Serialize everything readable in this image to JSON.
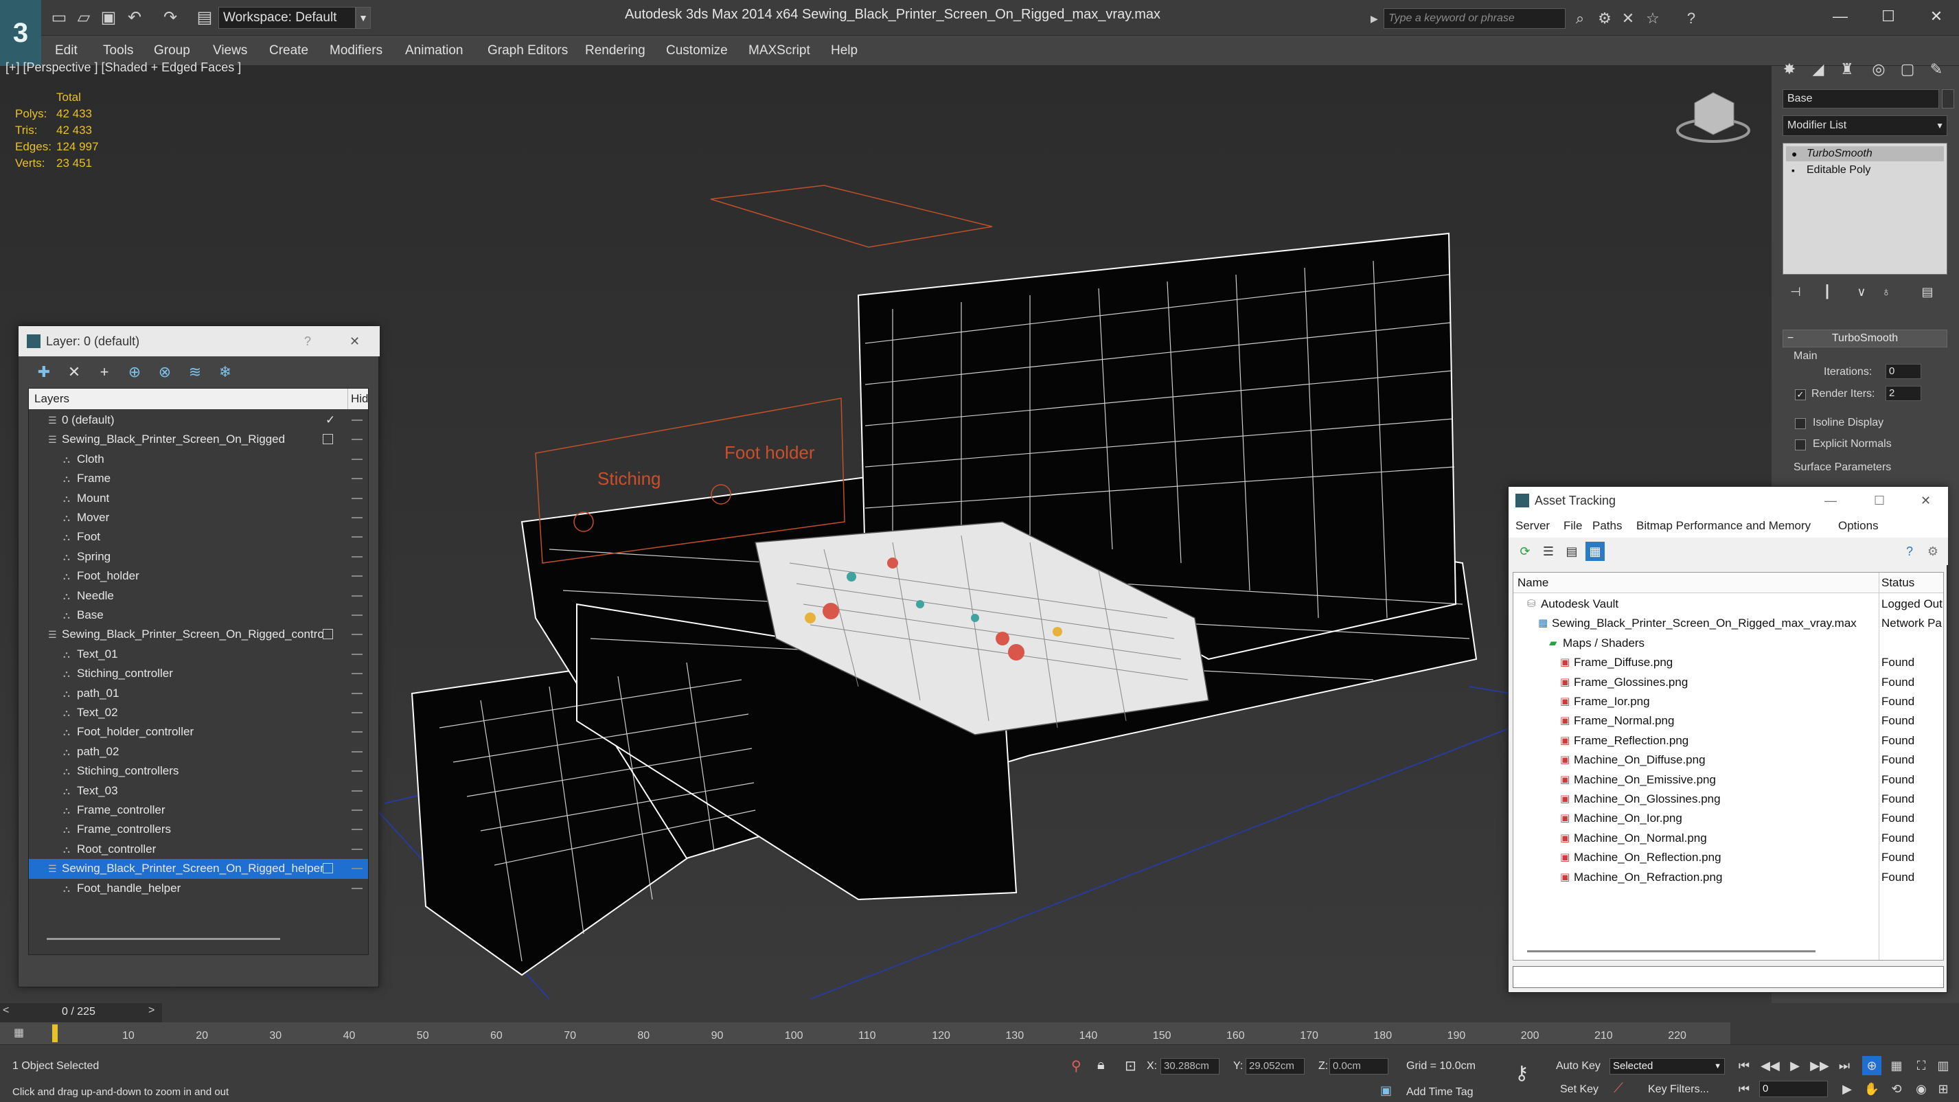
{
  "app": {
    "title": "Autodesk 3ds Max  2014 x64     Sewing_Black_Printer_Screen_On_Rigged_max_vray.max",
    "workspace": "Workspace: Default",
    "search_placeholder": "Type a keyword or phrase",
    "logo": "3"
  },
  "menu": [
    "Edit",
    "Tools",
    "Group",
    "Views",
    "Create",
    "Modifiers",
    "Animation",
    "Graph Editors",
    "Rendering",
    "Customize",
    "MAXScript",
    "Help"
  ],
  "viewport": {
    "label": "[+] [Perspective ] [Shaded + Edged Faces ]",
    "stats_header": "Total",
    "stats": [
      {
        "k": "Polys:",
        "v": "42 433"
      },
      {
        "k": "Tris:",
        "v": "42 433"
      },
      {
        "k": "Edges:",
        "v": "124 997"
      },
      {
        "k": "Verts:",
        "v": "23 451"
      }
    ],
    "scene_labels": {
      "stitching": "Stiching",
      "foot_holder": "Foot holder"
    }
  },
  "command_panel": {
    "object_name": "Base",
    "modifier_list": "Modifier List",
    "stack": [
      "TurboSmooth",
      "Editable Poly"
    ],
    "rollout": "TurboSmooth",
    "main_group": "Main",
    "iterations_label": "Iterations:",
    "iterations_value": "0",
    "render_iters_label": "Render Iters:",
    "render_iters_value": "2",
    "isoline_label": "Isoline Display",
    "explicit_normals_label": "Explicit Normals",
    "surface_params_label": "Surface Parameters"
  },
  "layer_window": {
    "title": "Layer: 0 (default)",
    "help": "?",
    "close": "✕",
    "col_layers": "Layers",
    "col_hide": "Hid",
    "rows": [
      {
        "name": "0 (default)",
        "indent": 1,
        "type": "layer",
        "checked": true
      },
      {
        "name": "Sewing_Black_Printer_Screen_On_Rigged",
        "indent": 1,
        "type": "layer",
        "box": true
      },
      {
        "name": "Cloth",
        "indent": 2,
        "type": "obj"
      },
      {
        "name": "Frame",
        "indent": 2,
        "type": "obj"
      },
      {
        "name": "Mount",
        "indent": 2,
        "type": "obj"
      },
      {
        "name": "Mover",
        "indent": 2,
        "type": "obj"
      },
      {
        "name": "Foot",
        "indent": 2,
        "type": "obj"
      },
      {
        "name": "Spring",
        "indent": 2,
        "type": "obj"
      },
      {
        "name": "Foot_holder",
        "indent": 2,
        "type": "obj"
      },
      {
        "name": "Needle",
        "indent": 2,
        "type": "obj"
      },
      {
        "name": "Base",
        "indent": 2,
        "type": "obj"
      },
      {
        "name": "Sewing_Black_Printer_Screen_On_Rigged_controllers",
        "indent": 1,
        "type": "layer",
        "box": true
      },
      {
        "name": "Text_01",
        "indent": 2,
        "type": "obj"
      },
      {
        "name": "Stiching_controller",
        "indent": 2,
        "type": "obj"
      },
      {
        "name": "path_01",
        "indent": 2,
        "type": "obj"
      },
      {
        "name": "Text_02",
        "indent": 2,
        "type": "obj"
      },
      {
        "name": "Foot_holder_controller",
        "indent": 2,
        "type": "obj"
      },
      {
        "name": "path_02",
        "indent": 2,
        "type": "obj"
      },
      {
        "name": "Stiching_controllers",
        "indent": 2,
        "type": "obj"
      },
      {
        "name": "Text_03",
        "indent": 2,
        "type": "obj"
      },
      {
        "name": "Frame_controller",
        "indent": 2,
        "type": "obj"
      },
      {
        "name": "Frame_controllers",
        "indent": 2,
        "type": "obj"
      },
      {
        "name": "Root_controller",
        "indent": 2,
        "type": "obj"
      },
      {
        "name": "Sewing_Black_Printer_Screen_On_Rigged_helpers",
        "indent": 1,
        "type": "layer",
        "box": true,
        "selected": true
      },
      {
        "name": "Foot_handle_helper",
        "indent": 2,
        "type": "obj"
      }
    ]
  },
  "asset_window": {
    "title": "Asset Tracking",
    "menus": [
      "Server",
      "File",
      "Paths",
      "Bitmap Performance and Memory",
      "Options"
    ],
    "col_name": "Name",
    "col_status": "Status",
    "rows": [
      {
        "name": "Autodesk Vault",
        "indent": 1,
        "status": "Logged Out"
      },
      {
        "name": "Sewing_Black_Printer_Screen_On_Rigged_max_vray.max",
        "indent": 2,
        "status": "Network Pa"
      },
      {
        "name": "Maps / Shaders",
        "indent": 3,
        "status": ""
      },
      {
        "name": "Frame_Diffuse.png",
        "indent": 4,
        "status": "Found"
      },
      {
        "name": "Frame_Glossines.png",
        "indent": 4,
        "status": "Found"
      },
      {
        "name": "Frame_Ior.png",
        "indent": 4,
        "status": "Found"
      },
      {
        "name": "Frame_Normal.png",
        "indent": 4,
        "status": "Found"
      },
      {
        "name": "Frame_Reflection.png",
        "indent": 4,
        "status": "Found"
      },
      {
        "name": "Machine_On_Diffuse.png",
        "indent": 4,
        "status": "Found"
      },
      {
        "name": "Machine_On_Emissive.png",
        "indent": 4,
        "status": "Found"
      },
      {
        "name": "Machine_On_Glossines.png",
        "indent": 4,
        "status": "Found"
      },
      {
        "name": "Machine_On_Ior.png",
        "indent": 4,
        "status": "Found"
      },
      {
        "name": "Machine_On_Normal.png",
        "indent": 4,
        "status": "Found"
      },
      {
        "name": "Machine_On_Reflection.png",
        "indent": 4,
        "status": "Found"
      },
      {
        "name": "Machine_On_Refraction.png",
        "indent": 4,
        "status": "Found"
      }
    ]
  },
  "timeline": {
    "frame": "0 / 225",
    "ticks": [
      "10",
      "20",
      "30",
      "40",
      "50",
      "60",
      "70",
      "80",
      "90",
      "100",
      "110",
      "120",
      "130",
      "140",
      "150",
      "160",
      "170",
      "180",
      "190",
      "200",
      "210",
      "220"
    ]
  },
  "status": {
    "selection": "1 Object Selected",
    "hint": "Click and drag up-and-down to zoom in and out",
    "x_label": "X:",
    "x_value": "30.288cm",
    "y_label": "Y:",
    "y_value": "29.052cm",
    "z_label": "Z:",
    "z_value": "0.0cm",
    "grid": "Grid = 10.0cm",
    "add_time_tag": "Add Time Tag",
    "auto_key": "Auto Key",
    "set_key": "Set Key",
    "selected_dropdown": "Selected",
    "key_filters": "Key Filters...",
    "frame_field": "0"
  },
  "colors": {
    "accent": "#1f6fd0",
    "stats": "#e8c02a",
    "viewport_bg": "#333333",
    "wire": "#ffffff"
  }
}
